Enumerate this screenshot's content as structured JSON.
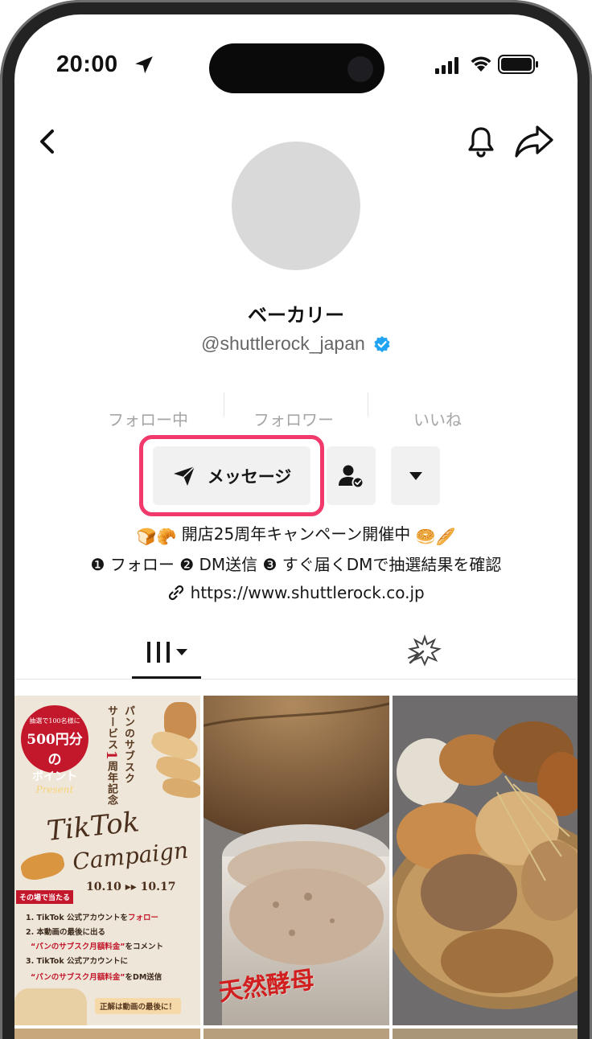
{
  "status_bar": {
    "time": "20:00"
  },
  "profile": {
    "display_name": "ベーカリー",
    "handle": "@shuttlerock_japan",
    "stats": {
      "following_label": "フォロー中",
      "followers_label": "フォロワー",
      "likes_label": "いいね"
    },
    "message_button_label": "メッセージ",
    "bio_line1": "開店25周年キャンペーン開催中",
    "bio_line1_emoji_left": "🍞🥐",
    "bio_line1_emoji_right": "🥯🥖",
    "bio_line2": "❶ フォロー ❷ DM送信 ❸ すぐ届くDMで抽選結果を確認",
    "link": "https://www.shuttlerock.co.jp"
  },
  "colors": {
    "highlight": "#f1396b",
    "verified": "#20a4f3",
    "poster_red": "#c3182b"
  },
  "videos": [
    {
      "badge_line1": "抽選で100名様に",
      "badge_line2": "500円分の",
      "badge_line3": "ポイント",
      "badge_line4": "Present",
      "vertical_title_a": "パンのサブスク",
      "vertical_title_b_1": "サービス",
      "vertical_title_b_num": "1",
      "vertical_title_b_2": "周年記念",
      "title_line1": "TikTok",
      "title_line2": "Campaign",
      "date_text": "10.10 ▸▸ 10.17",
      "label": "その場で当たる",
      "step1_prefix": "1. TikTok 公式アカウントを",
      "step1_highlight": "フォロー",
      "step2": "2. 本動画の最後に出る",
      "step2b_highlight": "“パンのサブスク月額料金”",
      "step2b_suffix": "をコメント",
      "step3": "3. TikTok 公式アカウントに",
      "step3b_highlight": "“パンのサブスク月額料金”",
      "step3b_suffix": "をDM送信",
      "footer": "正解は動画の最後に！"
    },
    {
      "overlay_text": "天然酵母"
    },
    {}
  ]
}
